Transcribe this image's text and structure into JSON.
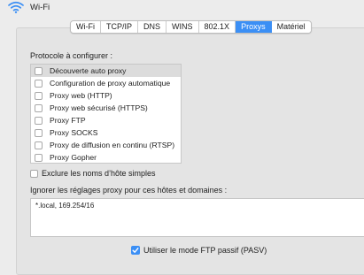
{
  "header": {
    "title": "Wi-Fi",
    "icon": "wifi-icon"
  },
  "tabs": [
    {
      "label": "Wi-Fi",
      "active": false
    },
    {
      "label": "TCP/IP",
      "active": false
    },
    {
      "label": "DNS",
      "active": false
    },
    {
      "label": "WINS",
      "active": false
    },
    {
      "label": "802.1X",
      "active": false
    },
    {
      "label": "Proxys",
      "active": true
    },
    {
      "label": "Matériel",
      "active": false
    }
  ],
  "protocols": {
    "heading": "Protocole à configurer :",
    "items": [
      {
        "label": "Découverte auto proxy",
        "checked": false,
        "selected": true
      },
      {
        "label": "Configuration de proxy automatique",
        "checked": false,
        "selected": false
      },
      {
        "label": "Proxy web (HTTP)",
        "checked": false,
        "selected": false
      },
      {
        "label": "Proxy web sécurisé (HTTPS)",
        "checked": false,
        "selected": false
      },
      {
        "label": "Proxy FTP",
        "checked": false,
        "selected": false
      },
      {
        "label": "Proxy SOCKS",
        "checked": false,
        "selected": false
      },
      {
        "label": "Proxy de diffusion en continu (RTSP)",
        "checked": false,
        "selected": false
      },
      {
        "label": "Proxy Gopher",
        "checked": false,
        "selected": false
      }
    ]
  },
  "exclude_simple_hostnames": {
    "label": "Exclure les noms d’hôte simples",
    "checked": false
  },
  "bypass": {
    "heading": "Ignorer les réglages proxy pour ces hôtes et domaines :",
    "value": "*.local, 169.254/16"
  },
  "passive_ftp": {
    "label": "Utiliser le mode FTP passif (PASV)",
    "checked": true
  },
  "colors": {
    "accent": "#3b8ff5",
    "background": "#ececec",
    "panel": "#e4e4e4",
    "selected_row": "#dcdcdc"
  }
}
